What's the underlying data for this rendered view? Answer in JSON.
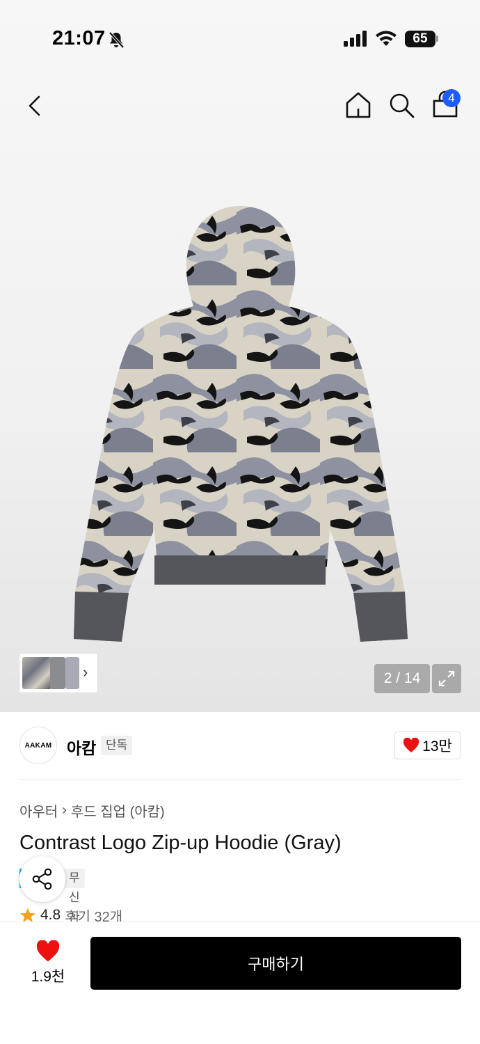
{
  "status_bar": {
    "time": "21:07",
    "battery": "65"
  },
  "header": {
    "cart_count": "4"
  },
  "gallery": {
    "counter": "2 / 14",
    "current": 2,
    "total": 14
  },
  "brand": {
    "logo_text": "AAKAM",
    "name": "아캄",
    "tag": "단독",
    "likes": "13만"
  },
  "breadcrumb": [
    "아우터",
    "후드 집업 (아캄)"
  ],
  "product": {
    "title": "Contrast Logo Zip-up Hoodie (Gray)",
    "badge": "무신사단독"
  },
  "rating": {
    "score": "4.8",
    "reviews": "후기 32개"
  },
  "bottom": {
    "wish_count": "1.9천",
    "buy_label": "구매하기"
  },
  "colors": {
    "accent_blue": "#1e5cff",
    "heart_red": "#ee1111",
    "buy_black": "#000000",
    "tag_cyan": "#00b2e3"
  },
  "icons": [
    "back-icon",
    "home-icon",
    "search-icon",
    "cart-icon",
    "expand-icon",
    "share-icon",
    "heart-icon",
    "star-icon",
    "mute-icon",
    "signal-icon",
    "wifi-icon"
  ]
}
